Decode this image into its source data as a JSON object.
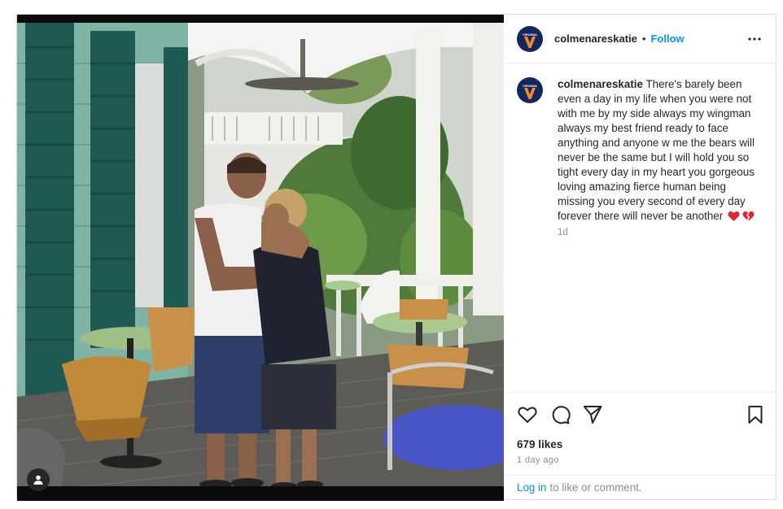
{
  "post": {
    "username": "colmenareskatie",
    "separator": "•",
    "follow_label": "Follow",
    "more_icon": "more-options-icon",
    "avatar_text": "VIRGINIA",
    "avatar_letter": "V",
    "caption": "There's barely been even a day in my life when you were not with me by my side always my wingman always my best friend ready to face anything and anyone w me the bears will never be the same but I will hold you so tight every day in my heart you gorgeous loving amazing fierce human being missing you every second of every day forever there will never be another",
    "caption_time": "1d",
    "likes": "679 likes",
    "time_ago": "1 day ago",
    "login_label": "Log in",
    "login_rest": "to like or comment.",
    "colors": {
      "avatar_bg": "#14275a",
      "avatar_accent": "#f28c28",
      "follow": "#0095f6",
      "secondary_text": "#8e8e8e"
    },
    "icons": [
      "heart-icon",
      "comment-icon",
      "share-icon",
      "save-icon",
      "user-tag-icon"
    ]
  }
}
